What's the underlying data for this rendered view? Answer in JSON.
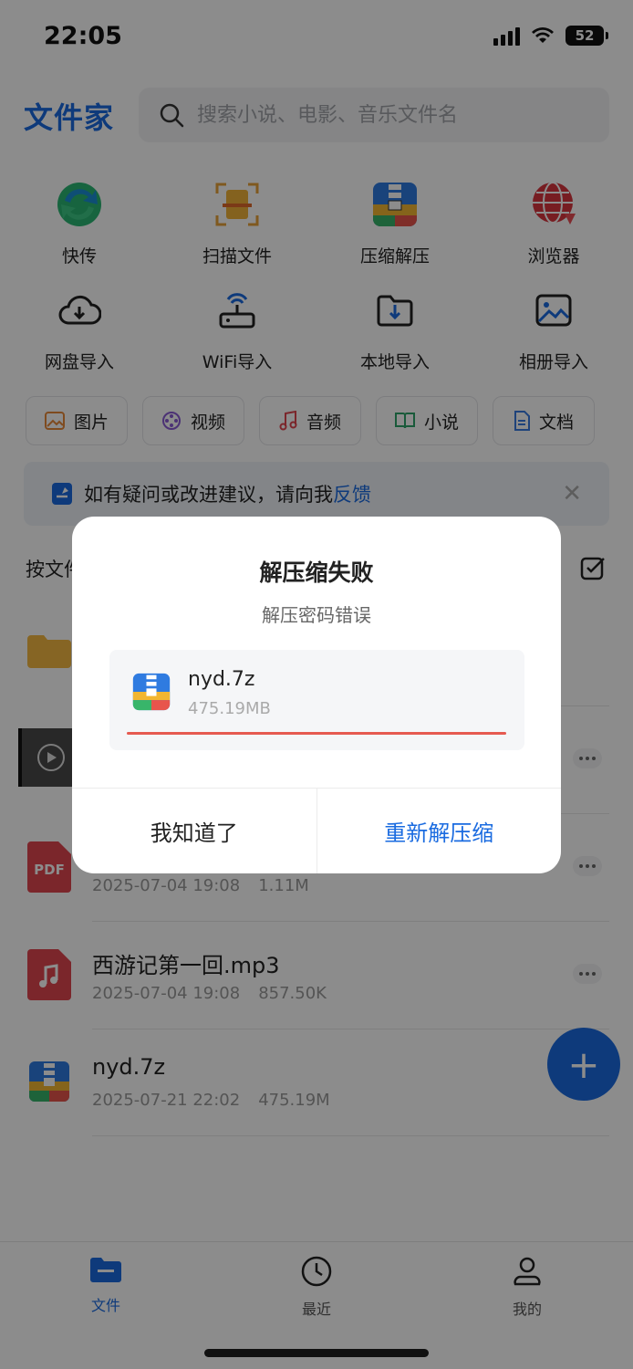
{
  "status": {
    "time": "22:05",
    "battery": "52"
  },
  "header": {
    "title": "文件家",
    "search_placeholder": "搜索小说、电影、音乐文件名"
  },
  "tools": [
    {
      "label": "快传",
      "icon": "quick-transfer-icon"
    },
    {
      "label": "扫描文件",
      "icon": "scan-icon"
    },
    {
      "label": "压缩解压",
      "icon": "archive-icon"
    },
    {
      "label": "浏览器",
      "icon": "browser-globe-icon"
    },
    {
      "label": "网盘导入",
      "icon": "cloud-download-icon"
    },
    {
      "label": "WiFi导入",
      "icon": "wifi-router-icon"
    },
    {
      "label": "本地导入",
      "icon": "folder-import-icon"
    },
    {
      "label": "相册导入",
      "icon": "photo-album-icon"
    }
  ],
  "chips": [
    {
      "label": "图片",
      "color": "#e8893a"
    },
    {
      "label": "视频",
      "color": "#8a5bd6"
    },
    {
      "label": "音频",
      "color": "#e0454f"
    },
    {
      "label": "小说",
      "color": "#2fa56a"
    },
    {
      "label": "文档",
      "color": "#3a7be0"
    }
  ],
  "notice": {
    "text": "如有疑问或改进建议，请向我",
    "link": "反馈"
  },
  "sort_label": "按文件",
  "files": [
    {
      "name": "",
      "date": "2025-07-04 19:08",
      "size": "1.11M",
      "type": "pdf"
    },
    {
      "name": "西游记第一回.mp3",
      "date": "2025-07-04 19:08",
      "size": "857.50K",
      "type": "audio"
    },
    {
      "name": "nyd.7z",
      "date": "2025-07-21 22:02",
      "size": "475.19M",
      "type": "archive"
    }
  ],
  "nav": [
    {
      "label": "文件",
      "active": true
    },
    {
      "label": "最近",
      "active": false
    },
    {
      "label": "我的",
      "active": false
    }
  ],
  "dialog": {
    "title": "解压缩失败",
    "subtitle": "解压密码错误",
    "file_name": "nyd.7z",
    "file_size": "475.19MB",
    "progress": 1.0,
    "cancel_label": "我知道了",
    "retry_label": "重新解压缩"
  },
  "colors": {
    "accent": "#1a6be0",
    "error": "#e65a50"
  }
}
